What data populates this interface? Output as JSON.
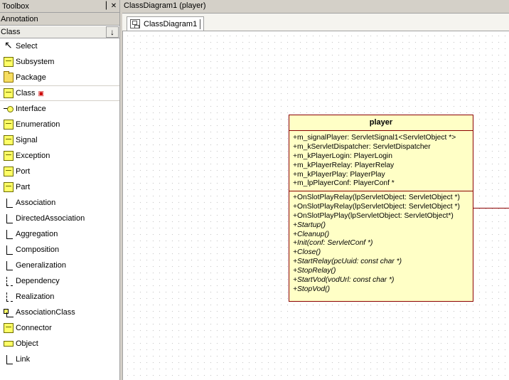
{
  "toolbox": {
    "title": "Toolbox",
    "pin_icon": "pin-icon",
    "close_icon": "close-icon",
    "groups": [
      {
        "label": "Annotation"
      },
      {
        "label": "Class"
      }
    ],
    "items": [
      {
        "label": "Select",
        "icon": "select-arrow-icon"
      },
      {
        "label": "Subsystem",
        "icon": "subsystem-icon"
      },
      {
        "label": "Package",
        "icon": "package-icon"
      },
      {
        "label": "Class",
        "icon": "class-icon",
        "locked": true
      },
      {
        "label": "Interface",
        "icon": "interface-icon"
      },
      {
        "label": "Enumeration",
        "icon": "enumeration-icon"
      },
      {
        "label": "Signal",
        "icon": "signal-icon"
      },
      {
        "label": "Exception",
        "icon": "exception-icon"
      },
      {
        "label": "Port",
        "icon": "port-icon"
      },
      {
        "label": "Part",
        "icon": "part-icon"
      },
      {
        "label": "Association",
        "icon": "association-icon"
      },
      {
        "label": "DirectedAssociation",
        "icon": "directed-association-icon"
      },
      {
        "label": "Aggregation",
        "icon": "aggregation-icon"
      },
      {
        "label": "Composition",
        "icon": "composition-icon"
      },
      {
        "label": "Generalization",
        "icon": "generalization-icon"
      },
      {
        "label": "Dependency",
        "icon": "dependency-icon"
      },
      {
        "label": "Realization",
        "icon": "realization-icon"
      },
      {
        "label": "AssociationClass",
        "icon": "association-class-icon"
      },
      {
        "label": "Connector",
        "icon": "connector-icon"
      },
      {
        "label": "Object",
        "icon": "object-icon"
      },
      {
        "label": "Link",
        "icon": "link-icon"
      }
    ]
  },
  "document": {
    "title": "ClassDiagram1 (player)",
    "tab_label": "ClassDiagram1"
  },
  "uml_class": {
    "name": "player",
    "attributes": [
      "+m_signalPlayer: ServletSignal1<ServletObject *>",
      "+m_kServletDispatcher: ServletDispatcher",
      "+m_kPlayerLogin: PlayerLogin",
      "+m_kPlayerRelay: PlayerRelay",
      "+m_kPlayerPlay: PlayerPlay",
      "+m_lpPlayerConf: PlayerConf  *"
    ],
    "operations": [
      {
        "text": "+OnSlotPlayRelay(lpServletObject: ServletObject *)",
        "abstract": false
      },
      {
        "text": "+OnSlotPlayRelay(lpServletObject: ServletObject *)",
        "abstract": false
      },
      {
        "text": "+OnSlotPlayPlay(lpServletObject: ServletObject*)",
        "abstract": false
      },
      {
        "text": "+Startup()",
        "abstract": true
      },
      {
        "text": "+Cleanup()",
        "abstract": true
      },
      {
        "text": "+Init(conf: ServletConf *)",
        "abstract": true
      },
      {
        "text": "+Close()",
        "abstract": true
      },
      {
        "text": "+StartRelay(pcUuid: const char *)",
        "abstract": true
      },
      {
        "text": "+StopRelay()",
        "abstract": true
      },
      {
        "text": "+StartVod(vodUrl: const char *)",
        "abstract": true
      },
      {
        "text": "+StopVod()",
        "abstract": true
      }
    ]
  },
  "colors": {
    "class_fill": "#ffffc6",
    "class_border": "#8b0000"
  }
}
